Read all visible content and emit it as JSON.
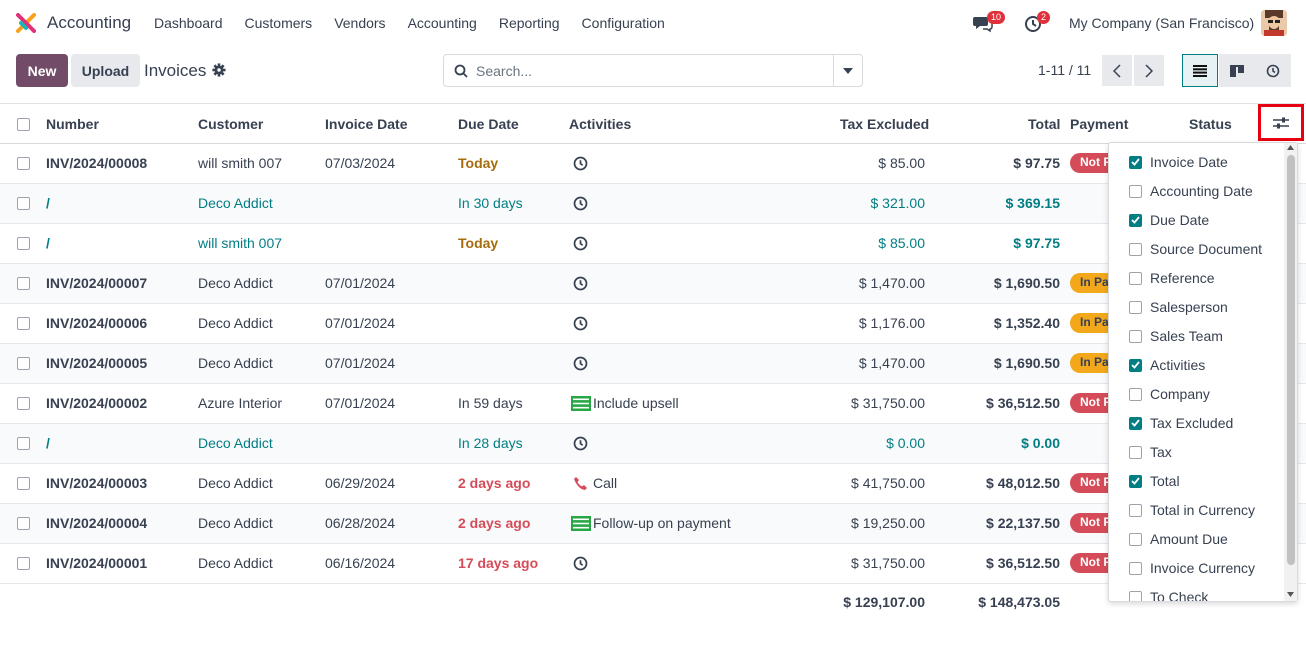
{
  "app": {
    "name": "Accounting"
  },
  "menu": [
    "Dashboard",
    "Customers",
    "Vendors",
    "Accounting",
    "Reporting",
    "Configuration"
  ],
  "nav": {
    "messages_count": "10",
    "activities_count": "2",
    "company": "My Company (San Francisco)"
  },
  "control": {
    "new_label": "New",
    "upload_label": "Upload",
    "breadcrumb": "Invoices",
    "search_placeholder": "Search...",
    "pager": "1-11 / 11"
  },
  "columns": {
    "number": "Number",
    "customer": "Customer",
    "invoice_date": "Invoice Date",
    "due_date": "Due Date",
    "activities": "Activities",
    "tax_excluded": "Tax Excluded",
    "total": "Total",
    "payment": "Payment",
    "status": "Status"
  },
  "rows": [
    {
      "number": "INV/2024/00008",
      "customer": "will smith 007",
      "invoice_date": "07/03/2024",
      "due": "Today",
      "due_style": "today",
      "activity": "",
      "activity_icon": "clock-icon",
      "tax_excluded": "$ 85.00",
      "total": "$ 97.75",
      "payment": "Not P",
      "payment_style": "notpaid",
      "draft": false
    },
    {
      "number": "/",
      "customer": "Deco Addict",
      "invoice_date": "",
      "due": "In 30 days",
      "due_style": "link",
      "activity": "",
      "activity_icon": "clock-icon",
      "tax_excluded": "$ 321.00",
      "total": "$ 369.15",
      "payment": "",
      "payment_style": "",
      "draft": true
    },
    {
      "number": "/",
      "customer": "will smith 007",
      "invoice_date": "",
      "due": "Today",
      "due_style": "today",
      "activity": "",
      "activity_icon": "clock-icon",
      "tax_excluded": "$ 85.00",
      "total": "$ 97.75",
      "payment": "",
      "payment_style": "",
      "draft": true
    },
    {
      "number": "INV/2024/00007",
      "customer": "Deco Addict",
      "invoice_date": "07/01/2024",
      "due": "",
      "due_style": "",
      "activity": "",
      "activity_icon": "clock-icon",
      "tax_excluded": "$ 1,470.00",
      "total": "$ 1,690.50",
      "payment": "In Pa",
      "payment_style": "inpay",
      "draft": false
    },
    {
      "number": "INV/2024/00006",
      "customer": "Deco Addict",
      "invoice_date": "07/01/2024",
      "due": "",
      "due_style": "",
      "activity": "",
      "activity_icon": "clock-icon",
      "tax_excluded": "$ 1,176.00",
      "total": "$ 1,352.40",
      "payment": "In Pa",
      "payment_style": "inpay",
      "draft": false
    },
    {
      "number": "INV/2024/00005",
      "customer": "Deco Addict",
      "invoice_date": "07/01/2024",
      "due": "",
      "due_style": "",
      "activity": "",
      "activity_icon": "clock-icon",
      "tax_excluded": "$ 1,470.00",
      "total": "$ 1,690.50",
      "payment": "In Pa",
      "payment_style": "inpay",
      "draft": false
    },
    {
      "number": "INV/2024/00002",
      "customer": "Azure Interior",
      "invoice_date": "07/01/2024",
      "due": "In 59 days",
      "due_style": "",
      "activity": "Include upsell",
      "activity_icon": "list-icon",
      "tax_excluded": "$ 31,750.00",
      "total": "$ 36,512.50",
      "payment": "Not P",
      "payment_style": "notpaid",
      "draft": false
    },
    {
      "number": "/",
      "customer": "Deco Addict",
      "invoice_date": "",
      "due": "In 28 days",
      "due_style": "link",
      "activity": "",
      "activity_icon": "clock-icon",
      "tax_excluded": "$ 0.00",
      "total": "$ 0.00",
      "payment": "",
      "payment_style": "",
      "draft": true
    },
    {
      "number": "INV/2024/00003",
      "customer": "Deco Addict",
      "invoice_date": "06/29/2024",
      "due": "2 days ago",
      "due_style": "late",
      "activity": "Call",
      "activity_icon": "phone-icon",
      "tax_excluded": "$ 41,750.00",
      "total": "$ 48,012.50",
      "payment": "Not P",
      "payment_style": "notpaid",
      "draft": false
    },
    {
      "number": "INV/2024/00004",
      "customer": "Deco Addict",
      "invoice_date": "06/28/2024",
      "due": "2 days ago",
      "due_style": "late",
      "activity": "Follow-up on payment",
      "activity_icon": "list-icon",
      "tax_excluded": "$ 19,250.00",
      "total": "$ 22,137.50",
      "payment": "Not P",
      "payment_style": "notpaid",
      "draft": false
    },
    {
      "number": "INV/2024/00001",
      "customer": "Deco Addict",
      "invoice_date": "06/16/2024",
      "due": "17 days ago",
      "due_style": "late",
      "activity": "",
      "activity_icon": "clock-icon",
      "tax_excluded": "$ 31,750.00",
      "total": "$ 36,512.50",
      "payment": "Not P",
      "payment_style": "notpaid",
      "draft": false
    }
  ],
  "totals": {
    "tax_excluded": "$ 129,107.00",
    "total": "$ 148,473.05"
  },
  "optional_columns": [
    {
      "label": "Invoice Date",
      "checked": true
    },
    {
      "label": "Accounting Date",
      "checked": false
    },
    {
      "label": "Due Date",
      "checked": true
    },
    {
      "label": "Source Document",
      "checked": false
    },
    {
      "label": "Reference",
      "checked": false
    },
    {
      "label": "Salesperson",
      "checked": false
    },
    {
      "label": "Sales Team",
      "checked": false
    },
    {
      "label": "Activities",
      "checked": true
    },
    {
      "label": "Company",
      "checked": false
    },
    {
      "label": "Tax Excluded",
      "checked": true
    },
    {
      "label": "Tax",
      "checked": false
    },
    {
      "label": "Total",
      "checked": true
    },
    {
      "label": "Total in Currency",
      "checked": false
    },
    {
      "label": "Amount Due",
      "checked": false
    },
    {
      "label": "Invoice Currency",
      "checked": false
    },
    {
      "label": "To Check",
      "checked": false
    }
  ],
  "colors": {
    "brand": "#714b67",
    "accent": "#017e84",
    "danger": "#d44c59",
    "warning": "#f3a81c",
    "highlight": "#e60012"
  }
}
